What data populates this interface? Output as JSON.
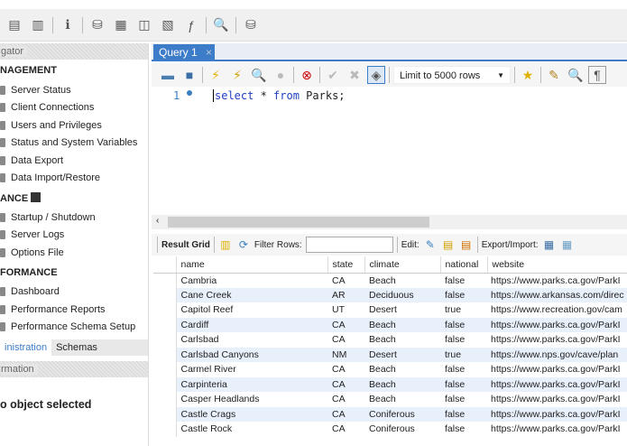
{
  "navigator": {
    "header": "gator",
    "management_title": "NAGEMENT",
    "management_items": [
      "Server Status",
      "Client Connections",
      "Users and Privileges",
      "Status and System Variables",
      "Data Export",
      "Data Import/Restore"
    ],
    "instance_title": "ANCE",
    "instance_items": [
      "Startup / Shutdown",
      "Server Logs",
      "Options File"
    ],
    "performance_title": "FORMANCE",
    "performance_items": [
      "Dashboard",
      "Performance Reports",
      "Performance Schema Setup"
    ],
    "tabs": [
      "inistration",
      "Schemas"
    ],
    "info_header": "rmation",
    "info_text": "o object selected"
  },
  "query_tab": {
    "label": "Query 1",
    "close": "×"
  },
  "toolbar": {
    "limit": "Limit to 5000 rows"
  },
  "editor": {
    "line_number": "1",
    "sql_keyword1": "select",
    "sql_mid": " * ",
    "sql_keyword2": "from",
    "sql_rest": " Parks;"
  },
  "result_toolbar": {
    "result_grid": "Result Grid",
    "filter_rows": "Filter Rows:",
    "filter_value": "",
    "edit": "Edit:",
    "export_import": "Export/Import:"
  },
  "grid": {
    "columns": [
      "name",
      "state",
      "climate",
      "national",
      "website"
    ],
    "rows": [
      [
        "Cambria",
        "CA",
        "Beach",
        "false",
        "https://www.parks.ca.gov/ParkI"
      ],
      [
        "Cane Creek",
        "AR",
        "Deciduous",
        "false",
        "https://www.arkansas.com/direc"
      ],
      [
        "Capitol Reef",
        "UT",
        "Desert",
        "true",
        "https://www.recreation.gov/cam"
      ],
      [
        "Cardiff",
        "CA",
        "Beach",
        "false",
        "https://www.parks.ca.gov/ParkI"
      ],
      [
        "Carlsbad",
        "CA",
        "Beach",
        "false",
        "https://www.parks.ca.gov/ParkI"
      ],
      [
        "Carlsbad Canyons",
        "NM",
        "Desert",
        "true",
        "https://www.nps.gov/cave/plan"
      ],
      [
        "Carmel River",
        "CA",
        "Beach",
        "false",
        "https://www.parks.ca.gov/ParkI"
      ],
      [
        "Carpinteria",
        "CA",
        "Beach",
        "false",
        "https://www.parks.ca.gov/ParkI"
      ],
      [
        "Casper Headlands",
        "CA",
        "Beach",
        "false",
        "https://www.parks.ca.gov/ParkI"
      ],
      [
        "Castle Crags",
        "CA",
        "Coniferous",
        "false",
        "https://www.parks.ca.gov/ParkI"
      ],
      [
        "Castle Rock",
        "CA",
        "Coniferous",
        "false",
        "https://www.parks.ca.gov/ParkI"
      ]
    ]
  }
}
